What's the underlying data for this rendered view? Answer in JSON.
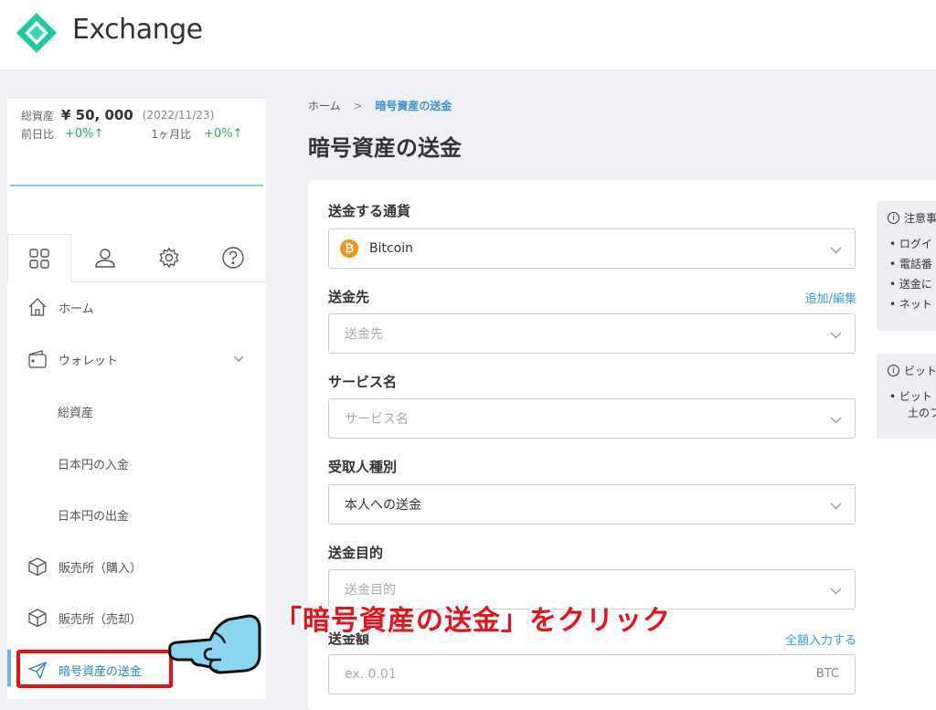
{
  "app": {
    "title": "Exchange"
  },
  "summary": {
    "total_label": "総資産",
    "total_value": "¥ 50, 000",
    "date": "(2022/11/23)",
    "prev_day_label": "前日比",
    "prev_day_value": "+0%↑",
    "month_label": "1ヶ月比",
    "month_value": "+0%↑"
  },
  "nav": {
    "home": "ホーム",
    "wallet": "ウォレット",
    "total_assets": "総資産",
    "jpy_deposit": "日本円の入金",
    "jpy_withdraw": "日本円の出金",
    "buy": "販売所（購入）",
    "sell": "販売所（売却）",
    "send_crypto": "暗号資産の送金"
  },
  "breadcrumb": {
    "home": "ホーム",
    "sep": ">",
    "current": "暗号資産の送金"
  },
  "page_title": "暗号資産の送金",
  "form": {
    "currency_label": "送金する通貨",
    "currency_value": "Bitcoin",
    "currency_icon": "₿",
    "dest_label": "送金先",
    "dest_link": "追加/編集",
    "dest_placeholder": "送金先",
    "service_label": "サービス名",
    "service_placeholder": "サービス名",
    "recipient_label": "受取人種別",
    "recipient_value": "本人への送金",
    "purpose_label": "送金目的",
    "purpose_placeholder": "送金目的",
    "amount_label": "送金額",
    "amount_link": "全額入力する",
    "amount_placeholder": "ex. 0.01",
    "amount_unit": "BTC"
  },
  "notes": {
    "note1_title": "注意事",
    "note1_items": [
      "• ログイ",
      "• 電話番",
      "• 送金に",
      "• ネット"
    ],
    "note2_title": "ビット",
    "note2_items": [
      "• ビット",
      "土のフ"
    ]
  },
  "annotation": {
    "instruction": "「暗号資産の送金」をクリック"
  },
  "colors": {
    "accent": "#3a9fd8",
    "highlight": "#e8121b",
    "positive": "#2faa6a",
    "bitcoin": "#f7931a",
    "logo": "#21c9a0"
  }
}
